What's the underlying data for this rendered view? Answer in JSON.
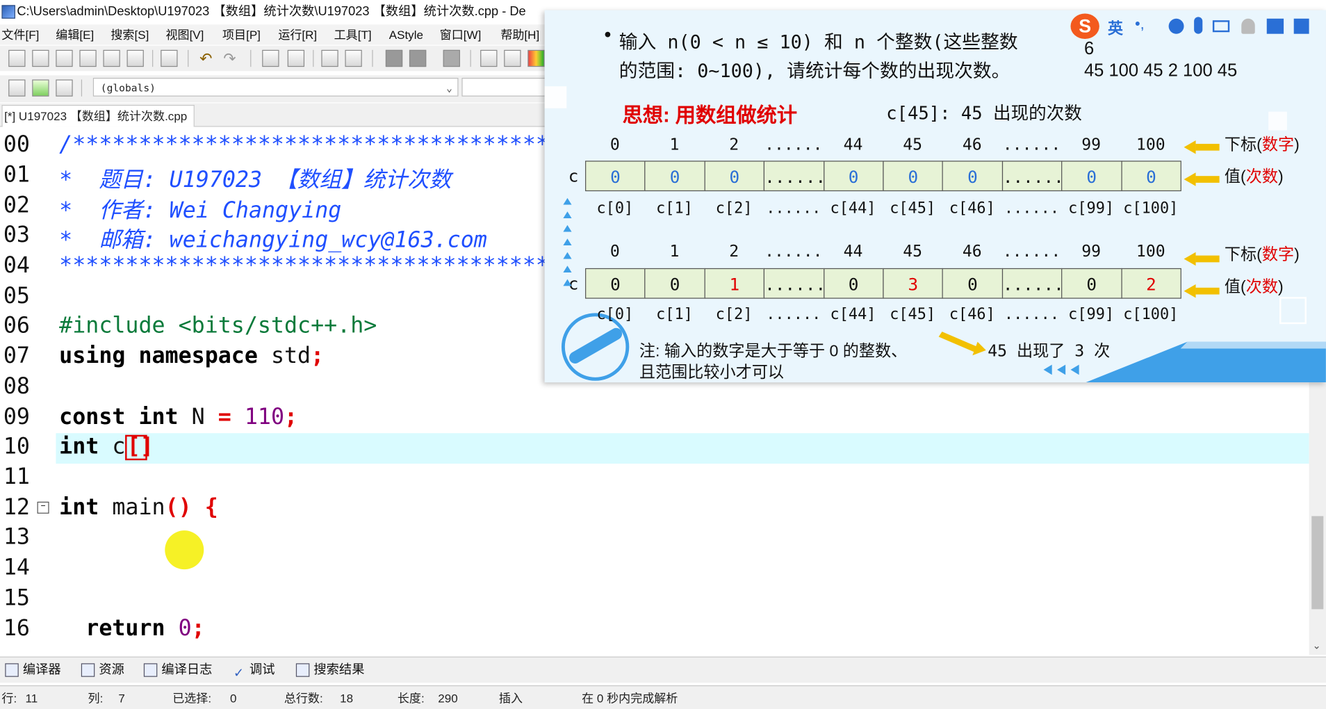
{
  "window": {
    "title": "C:\\Users\\admin\\Desktop\\U197023 【数组】统计次数\\U197023 【数组】统计次数.cpp - De"
  },
  "menu": [
    "文件[F]",
    "编辑[E]",
    "搜索[S]",
    "视图[V]",
    "项目[P]",
    "运行[R]",
    "工具[T]",
    "AStyle",
    "窗口[W]",
    "帮助[H]"
  ],
  "toolbar": {
    "scope_select": "(globals)"
  },
  "file_tab": "[*] U197023 【数组】统计次数.cpp",
  "editor": {
    "line_numbers": [
      "00",
      "01",
      "02",
      "03",
      "04",
      "05",
      "06",
      "07",
      "08",
      "09",
      "10",
      "11",
      "12",
      "13",
      "14",
      "15",
      "16"
    ],
    "comment_border": "/************************************",
    "comment_title": "*  题目: U197023 【数组】统计次数",
    "comment_author": "*  作者: Wei Changying",
    "comment_email": "*  邮箱: weichangying_wcy@163.com",
    "comment_end": "*************************************",
    "include": "#include <bits/stdc++.h>",
    "using_kw": "using namespace",
    "using_rest": " std",
    "semi": ";",
    "const_kw": "const int",
    "const_rest": " N ",
    "eq": "=",
    "const_num": " 110",
    "int_kw": "int",
    "c_name": " c",
    "bracket": "[]",
    "main_kw": "int",
    "main_name": " main",
    "main_paren": "()",
    "main_brace": " {",
    "return_kw": "return",
    "return_num": " 0"
  },
  "bottom_tabs": [
    "编译器",
    "资源",
    "编译日志",
    "调试",
    "搜索结果"
  ],
  "status": {
    "row_label": "行:",
    "row": "11",
    "col_label": "列:",
    "col": "7",
    "sel_label": "已选择:",
    "sel": "0",
    "total_label": "总行数:",
    "total": "18",
    "len_label": "长度:",
    "len": "290",
    "mode": "插入",
    "parse": "在 0 秒内完成解析"
  },
  "slide": {
    "bullet": "•",
    "problem_line1": "输入 n(0 < n ≤ 10) 和 n 个整数(这些整数",
    "problem_line2": "的范围: 0~100), 请统计每个数的出现次数。",
    "input_line1": "6",
    "input_line2": "45 100 45 2 100 45",
    "idea": "思想: 用数组做统计",
    "idea_note": "c[45]: 45 出现的次数",
    "array_name": "c",
    "indices": [
      "0",
      "1",
      "2",
      "......",
      "44",
      "45",
      "46",
      "......",
      "99",
      "100"
    ],
    "labels": [
      "c[0]",
      "c[1]",
      "c[2]",
      "......",
      "c[44]",
      "c[45]",
      "c[46]",
      "......",
      "c[99]",
      "c[100]"
    ],
    "values_initial": [
      "0",
      "0",
      "0",
      "......",
      "0",
      "0",
      "0",
      "......",
      "0",
      "0"
    ],
    "values_final": [
      "0",
      "0",
      "1",
      "......",
      "0",
      "3",
      "0",
      "......",
      "0",
      "2"
    ],
    "legend_index_prefix": "下标(",
    "legend_index_word": "数字",
    "legend_value_prefix": "值(",
    "legend_value_word": "次数",
    "legend_close": ")",
    "note_line1": "注: 输入的数字是大于等于 0 的整数、",
    "note_line2": "且范围比较小才可以",
    "arrow_note": "45 出现了 3 次"
  },
  "ime": {
    "lang": "英",
    "punct": "•,"
  },
  "colors": {
    "accent_red": "#e00000",
    "comment_blue": "#1f4fff",
    "highlight_line": "#d9fbff",
    "cell_green": "#e7f3d6"
  }
}
